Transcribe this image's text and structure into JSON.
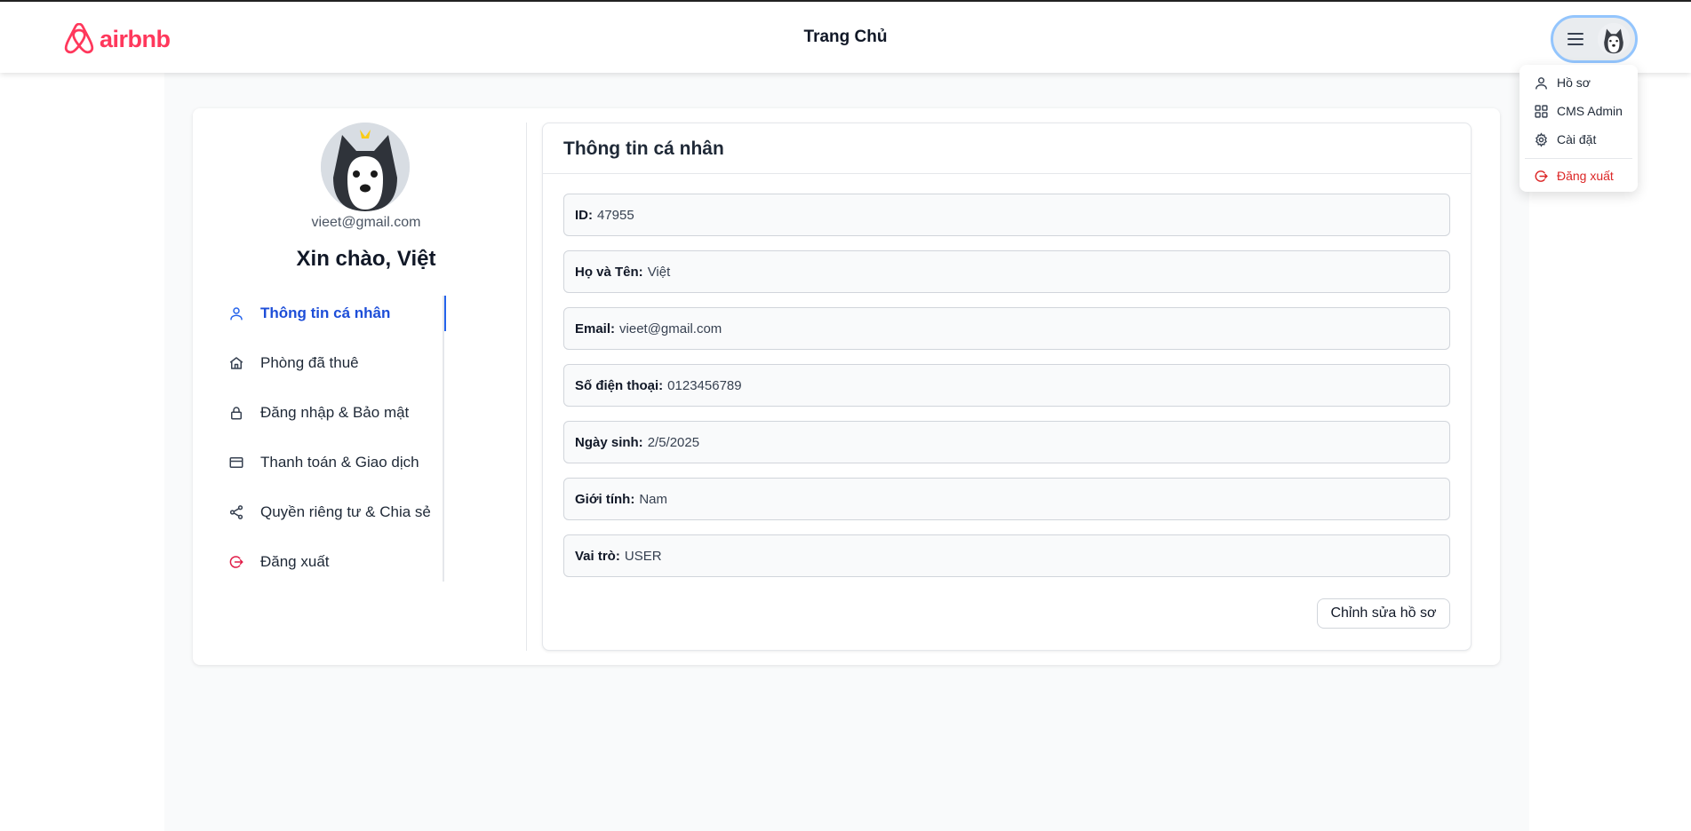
{
  "header": {
    "logo_text": "airbnb",
    "title": "Trang Chủ",
    "menu_icon": "hamburger-icon",
    "avatar_icon": "husky-avatar"
  },
  "dropdown": {
    "items": [
      {
        "label": "Hồ sơ",
        "icon": "user-icon"
      },
      {
        "label": "CMS Admin",
        "icon": "grid-icon"
      },
      {
        "label": "Cài đặt",
        "icon": "gear-icon"
      }
    ],
    "logout": {
      "label": "Đăng xuất",
      "icon": "logout-icon"
    }
  },
  "profile": {
    "email": "vieet@gmail.com",
    "greeting": "Xin chào, Việt"
  },
  "sidebar": {
    "items": [
      {
        "label": "Thông tin cá nhân",
        "icon": "user-icon",
        "active": true
      },
      {
        "label": "Phòng đã thuê",
        "icon": "home-icon"
      },
      {
        "label": "Đăng nhập & Bảo mật",
        "icon": "lock-icon"
      },
      {
        "label": "Thanh toán & Giao dịch",
        "icon": "card-icon"
      },
      {
        "label": "Quyền riêng tư & Chia sẻ",
        "icon": "share-icon"
      },
      {
        "label": "Đăng xuất",
        "icon": "logout-icon"
      }
    ]
  },
  "info": {
    "title": "Thông tin cá nhân",
    "fields": [
      {
        "label": "ID:",
        "value": "47955"
      },
      {
        "label": "Họ và Tên:",
        "value": "Việt"
      },
      {
        "label": "Email:",
        "value": "vieet@gmail.com"
      },
      {
        "label": "Số điện thoại:",
        "value": "0123456789"
      },
      {
        "label": "Ngày sinh:",
        "value": "2/5/2025"
      },
      {
        "label": "Giới tính:",
        "value": "Nam"
      },
      {
        "label": "Vai trò:",
        "value": "USER"
      }
    ],
    "edit_label": "Chỉnh sửa hồ sơ"
  },
  "colors": {
    "brand": "#ff385c",
    "accent": "#2563eb",
    "danger": "#dc2626"
  }
}
